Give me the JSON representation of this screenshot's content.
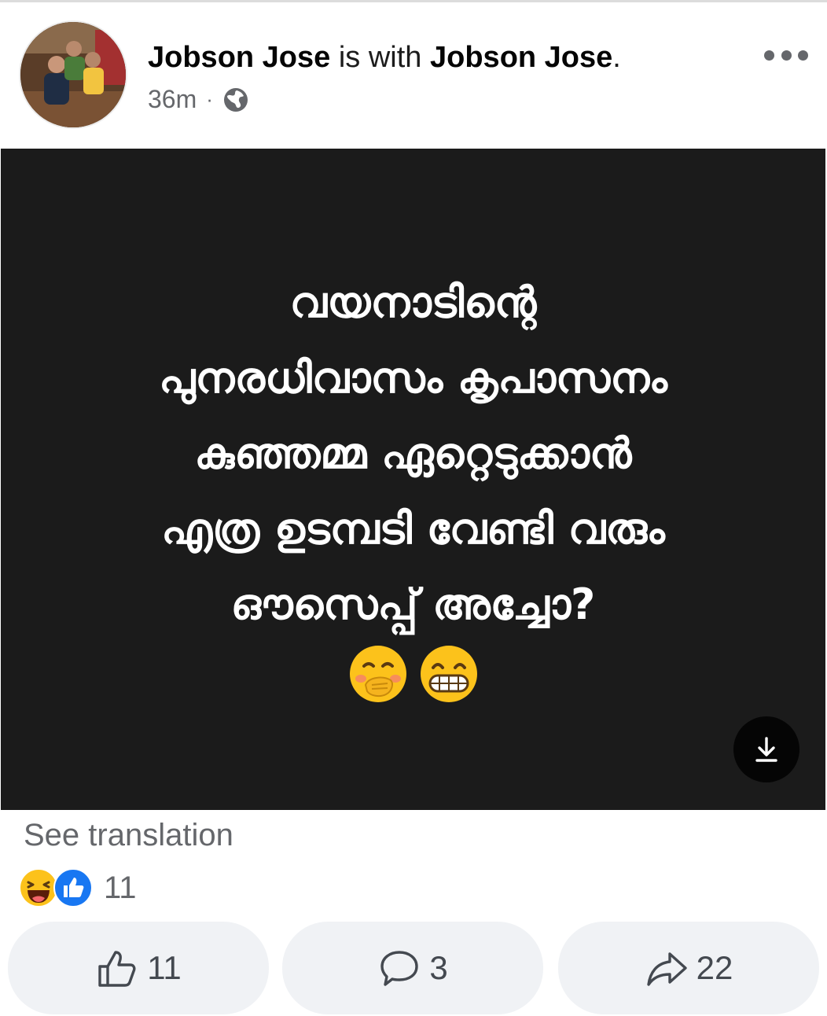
{
  "header": {
    "author": "Jobson Jose",
    "connector": " is with ",
    "tagged": "Jobson Jose",
    "period": ".",
    "time": "36m",
    "separator": "·",
    "privacy_icon": "globe-icon",
    "more_icon": "more-horizontal-icon"
  },
  "post": {
    "text_lines": [
      "വയനാടിന്റെ",
      "പുനരധിവാസം കൃപാസനം",
      "കുഞ്ഞമ്മ ഏറ്റെടുക്കാൻ",
      "എത്ര ഉടമ്പടി വേണ്ടി വരും",
      "ഔസെപ്പ് അച്ചോ?"
    ],
    "emojis": [
      "face-with-hand-over-mouth-emoji",
      "grinning-face-emoji"
    ],
    "download_icon": "download-icon",
    "background_color": "#1b1b1b"
  },
  "see_translation": "See translation",
  "reactions": {
    "icons": [
      "haha-reaction-icon",
      "like-reaction-icon"
    ],
    "count": "11"
  },
  "actions": {
    "like": {
      "icon": "thumbs-up-icon",
      "count": "11"
    },
    "comment": {
      "icon": "comment-icon",
      "count": "3"
    },
    "share": {
      "icon": "share-icon",
      "count": "22"
    }
  },
  "colors": {
    "secondary_text": "#65676b",
    "button_bg": "#f0f2f5",
    "like_blue": "#1877f2",
    "emoji_yellow": "#fcc21b"
  }
}
